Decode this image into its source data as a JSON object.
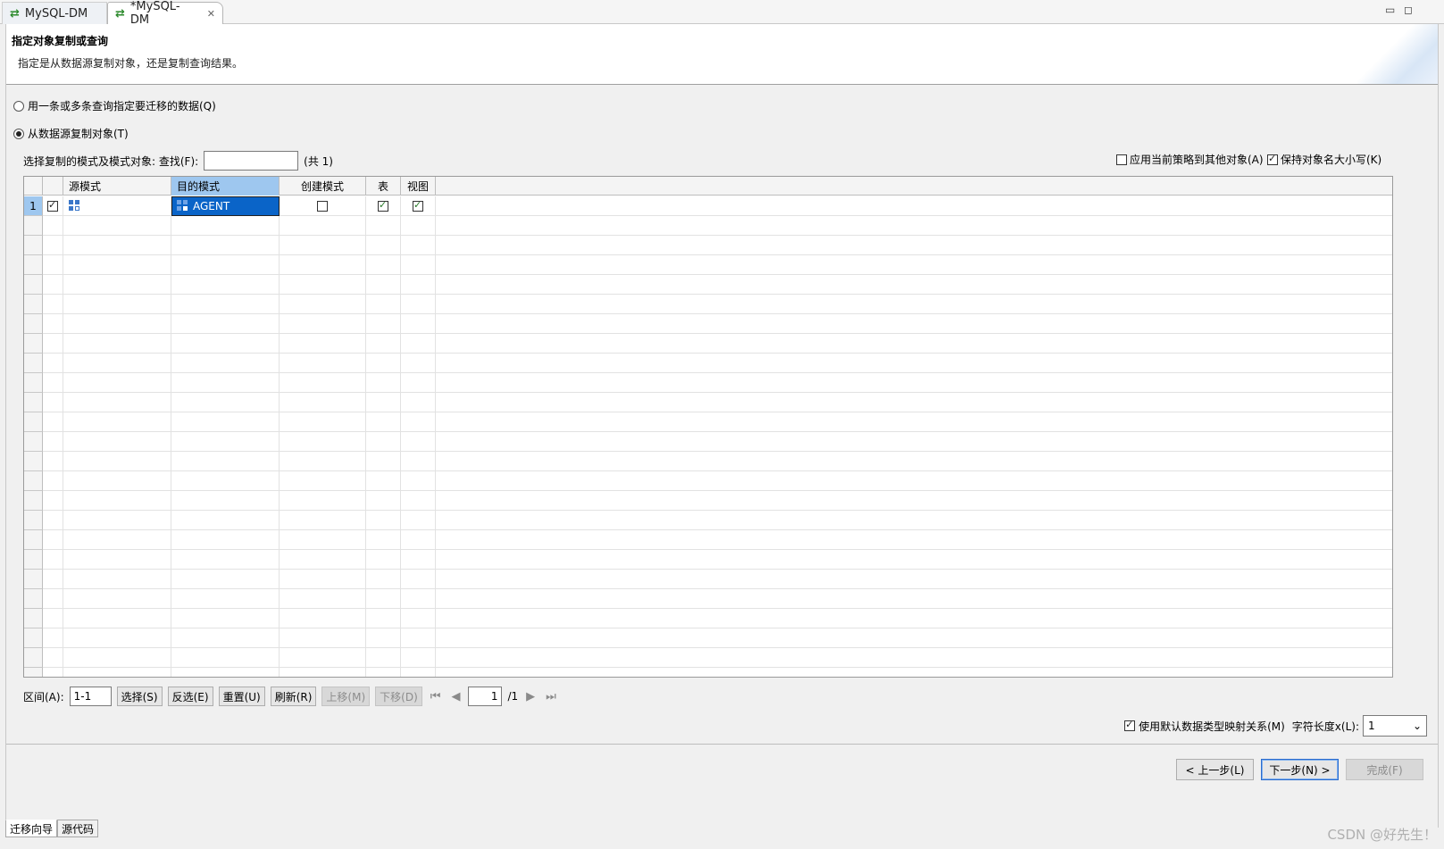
{
  "tabs": [
    {
      "label": "MySQL-DM"
    },
    {
      "label": "*MySQL-DM"
    }
  ],
  "window_controls": {
    "minimize": "▭",
    "maximize": "◻"
  },
  "wizard": {
    "title": "指定对象复制或查询",
    "description": "指定是从数据源复制对象，还是复制查询结果。",
    "radio_query": {
      "label": "用一条或多条查询指定要迁移的数据(Q)",
      "selected": false
    },
    "radio_copy": {
      "label": "从数据源复制对象(T)",
      "selected": true
    },
    "find": {
      "label": "选择复制的模式及模式对象: 查找(F):",
      "value": "",
      "count": "(共 1)"
    },
    "opt_apply": {
      "label": "应用当前策略到其他对象(A)",
      "checked": false
    },
    "opt_keep_case": {
      "label": "保持对象名大小写(K)",
      "checked": true
    }
  },
  "grid": {
    "columns": [
      "源模式",
      "目的模式",
      "创建模式",
      "表",
      "视图"
    ],
    "rows": [
      {
        "num": "1",
        "checked": true,
        "source": "",
        "target": "AGENT",
        "create": false,
        "table": true,
        "view": true
      }
    ]
  },
  "toolbar": {
    "range_label": "区间(A):",
    "range_value": "1-1",
    "select": "选择(S)",
    "invert": "反选(E)",
    "reset": "重置(U)",
    "refresh": "刷新(R)",
    "move_up": "上移(M)",
    "move_down": "下移(D)",
    "page_value": "1",
    "page_total": "/1"
  },
  "mapping": {
    "label": "使用默认数据类型映射关系(M)",
    "checked": true,
    "charlen_label": "字符长度x(L):",
    "charlen_value": "1"
  },
  "buttons": {
    "back": "< 上一步(L)",
    "next": "下一步(N) >",
    "finish": "完成(F)"
  },
  "page_tabs": [
    "迁移向导",
    "源代码"
  ],
  "watermark": "CSDN @好先生！",
  "colors": {
    "selection": "#0a64c8",
    "header_selected": "#9ec7ef"
  }
}
